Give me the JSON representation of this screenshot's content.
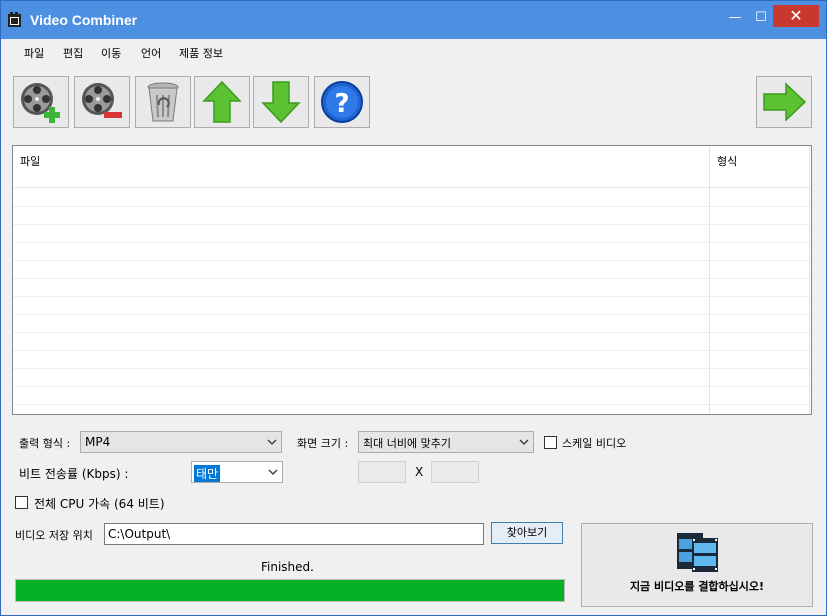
{
  "window": {
    "title": "Video Combiner",
    "controls": {
      "minimize": "—",
      "maximize": "☐",
      "close": "✕"
    }
  },
  "menu": [
    "파일",
    "편집",
    "이동",
    "언어",
    "제품 정보"
  ],
  "toolbar": {
    "buttons": [
      {
        "name": "add-video",
        "icon": "film-reel-plus-icon"
      },
      {
        "name": "remove-video",
        "icon": "film-reel-minus-icon"
      },
      {
        "name": "clear-list",
        "icon": "recycle-bin-icon"
      },
      {
        "name": "move-up",
        "icon": "arrow-up-icon"
      },
      {
        "name": "move-down",
        "icon": "arrow-down-icon"
      },
      {
        "name": "help",
        "icon": "question-icon"
      },
      {
        "name": "next",
        "icon": "arrow-right-icon"
      }
    ]
  },
  "file_list": {
    "columns": [
      "파일",
      "형식"
    ],
    "rows": []
  },
  "options": {
    "output_format_label": "출력 형식 :",
    "output_format_value": "MP4",
    "screen_size_label": "화면 크기 :",
    "screen_size_value": "최대 너비에 맞추기",
    "scale_video_label": "스케일 비디오",
    "scale_video_checked": false,
    "bitrate_label": "비트 전송률 (Kbps) :",
    "bitrate_value": "태만",
    "width_value": "",
    "height_value": "",
    "size_separator": "X",
    "cpu_accel_label": "전체 CPU 가속 (64 비트)",
    "cpu_accel_checked": false,
    "save_location_label": "비디오 저장 위치",
    "save_location_value": "C:\\Output\\",
    "browse_label": "찾아보기"
  },
  "status": {
    "text": "Finished.",
    "progress_percent": 100,
    "progress_color": "#06b025"
  },
  "combine_button": {
    "label": "지금 비디오를 결합하십시오!",
    "icon": "film-strip-icon"
  },
  "colors": {
    "titlebar": "#4d90e2",
    "close": "#c7392e",
    "accent_green": "#3cb63c",
    "help_blue": "#1e64d2"
  }
}
